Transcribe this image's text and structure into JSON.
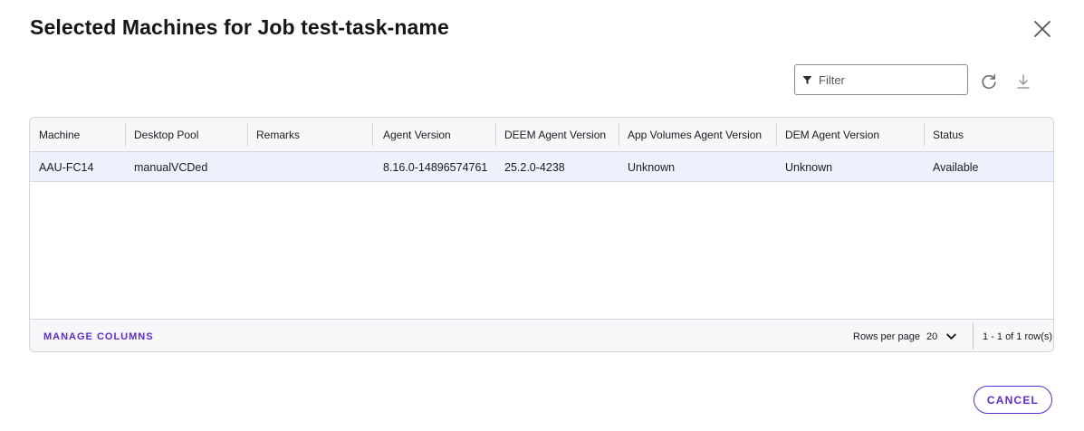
{
  "dialog": {
    "title": "Selected Machines for Job test-task-name",
    "close_icon": "close-icon"
  },
  "toolbar": {
    "filter_placeholder": "Filter",
    "filter_icon": "filter-icon",
    "refresh_icon": "refresh-icon",
    "download_icon": "download-icon"
  },
  "table": {
    "columns": [
      "Machine",
      "Desktop Pool",
      "Remarks",
      "Agent Version",
      "DEEM Agent Version",
      "App Volumes Agent Version",
      "DEM Agent Version",
      "Status"
    ],
    "rows": [
      [
        "AAU-FC14",
        "manualVCDed",
        "",
        "8.16.0-14896574761",
        "25.2.0-4238",
        "Unknown",
        "Unknown",
        "Available"
      ]
    ],
    "selected_row_color": "#eef0fb"
  },
  "footer": {
    "manage_columns": "MANAGE COLUMNS",
    "rows_per_page_label": "Rows per page",
    "rows_per_page_value": "20",
    "range": "1 - 1 of 1 row(s)"
  },
  "actions": {
    "cancel": "CANCEL"
  },
  "colors": {
    "accent": "#5b2bd5",
    "border": "#d4d4dc",
    "header_bg": "#f7f7fa"
  }
}
